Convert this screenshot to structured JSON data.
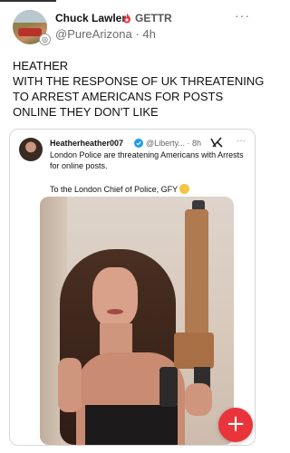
{
  "post": {
    "author_name": "Chuck Lawler",
    "platform": "GETTR",
    "handle": "@PureArizona",
    "separator": "·",
    "time": "4h",
    "more": "···",
    "text_lines": [
      "HEATHER",
      "WITH THE RESPONSE OF UK THREATENING",
      "TO ARREST AMERICANS FOR POSTS",
      "ONLINE THEY DON'T LIKE"
    ]
  },
  "quote": {
    "author": "Heatherheather007",
    "meta": "@Liberty... · 8h",
    "more": "···",
    "text": "London Police are threatening Americans with Arrests for online posts.",
    "text2": "To the London Chief of Police, GFY",
    "emoji": "grimacing-face-emoji"
  },
  "fab": {
    "label": "+"
  },
  "colors": {
    "accent": "#e8343a",
    "verified": "#1d9bf0",
    "muted": "#6b6b6b"
  }
}
